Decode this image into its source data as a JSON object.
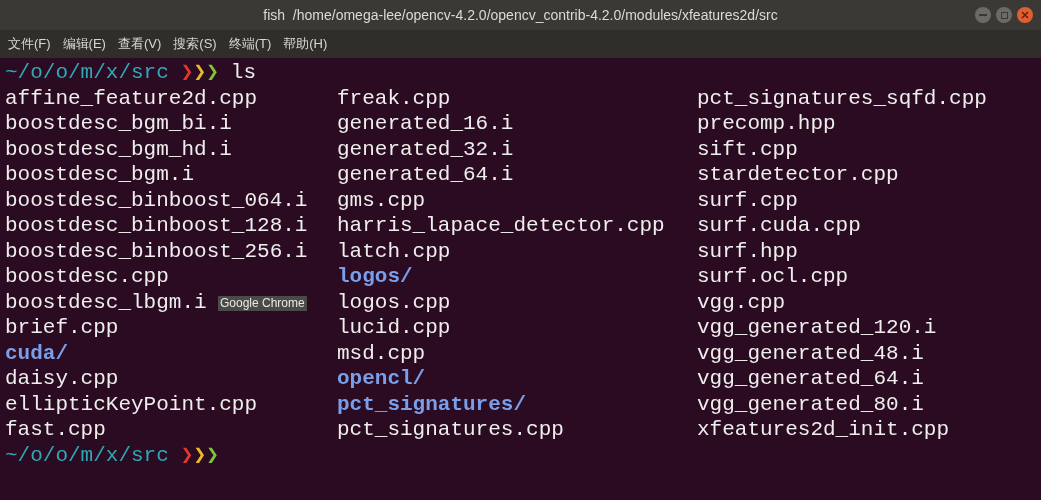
{
  "window": {
    "title": "fish  /home/omega-lee/opencv-4.2.0/opencv_contrib-4.2.0/modules/xfeatures2d/src"
  },
  "menu": [
    "文件(F)",
    "编辑(E)",
    "查看(V)",
    "搜索(S)",
    "终端(T)",
    "帮助(H)"
  ],
  "prompt": {
    "path": "~/o/o/m/x/src",
    "arrows": [
      {
        "text": "❯",
        "color": "#e0362b"
      },
      {
        "text": "❯",
        "color": "#e8b92a"
      },
      {
        "text": "❯",
        "color": "#7fc33a"
      }
    ],
    "command": "ls"
  },
  "listing": [
    [
      {
        "name": "affine_feature2d.cpp",
        "kind": "file"
      },
      {
        "name": "boostdesc_bgm_bi.i",
        "kind": "file"
      },
      {
        "name": "boostdesc_bgm_hd.i",
        "kind": "file"
      },
      {
        "name": "boostdesc_bgm.i",
        "kind": "file"
      },
      {
        "name": "boostdesc_binboost_064.i",
        "kind": "file"
      },
      {
        "name": "boostdesc_binboost_128.i",
        "kind": "file"
      },
      {
        "name": "boostdesc_binboost_256.i",
        "kind": "file"
      },
      {
        "name": "boostdesc.cpp",
        "kind": "file"
      },
      {
        "name": "boostdesc_lbgm.i",
        "kind": "file"
      },
      {
        "name": "brief.cpp",
        "kind": "file"
      },
      {
        "name": "cuda/",
        "kind": "dir"
      },
      {
        "name": "daisy.cpp",
        "kind": "file"
      },
      {
        "name": "ellipticKeyPoint.cpp",
        "kind": "file"
      },
      {
        "name": "fast.cpp",
        "kind": "file"
      }
    ],
    [
      {
        "name": "freak.cpp",
        "kind": "file"
      },
      {
        "name": "generated_16.i",
        "kind": "file"
      },
      {
        "name": "generated_32.i",
        "kind": "file"
      },
      {
        "name": "generated_64.i",
        "kind": "file"
      },
      {
        "name": "gms.cpp",
        "kind": "file"
      },
      {
        "name": "harris_lapace_detector.cpp",
        "kind": "file"
      },
      {
        "name": "latch.cpp",
        "kind": "file"
      },
      {
        "name": "logos/",
        "kind": "dir"
      },
      {
        "name": "logos.cpp",
        "kind": "file"
      },
      {
        "name": "lucid.cpp",
        "kind": "file"
      },
      {
        "name": "msd.cpp",
        "kind": "file"
      },
      {
        "name": "opencl/",
        "kind": "dir"
      },
      {
        "name": "pct_signatures/",
        "kind": "dir"
      },
      {
        "name": "pct_signatures.cpp",
        "kind": "file"
      }
    ],
    [
      {
        "name": "pct_signatures_sqfd.cpp",
        "kind": "file"
      },
      {
        "name": "precomp.hpp",
        "kind": "file"
      },
      {
        "name": "sift.cpp",
        "kind": "file"
      },
      {
        "name": "stardetector.cpp",
        "kind": "file"
      },
      {
        "name": "surf.cpp",
        "kind": "file"
      },
      {
        "name": "surf.cuda.cpp",
        "kind": "file"
      },
      {
        "name": "surf.hpp",
        "kind": "file"
      },
      {
        "name": "surf.ocl.cpp",
        "kind": "file"
      },
      {
        "name": "vgg.cpp",
        "kind": "file"
      },
      {
        "name": "vgg_generated_120.i",
        "kind": "file"
      },
      {
        "name": "vgg_generated_48.i",
        "kind": "file"
      },
      {
        "name": "vgg_generated_64.i",
        "kind": "file"
      },
      {
        "name": "vgg_generated_80.i",
        "kind": "file"
      },
      {
        "name": "xfeatures2d_init.cpp",
        "kind": "file"
      }
    ]
  ],
  "next_prompt": {
    "path": "~/o/o/m/x/src",
    "arrows": [
      {
        "text": "❯",
        "color": "#e0362b"
      },
      {
        "text": "❯",
        "color": "#e8b92a"
      },
      {
        "text": "❯",
        "color": "#7fc33a"
      }
    ]
  },
  "tooltip": "Google Chrome"
}
